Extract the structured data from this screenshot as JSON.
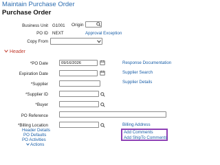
{
  "app": {
    "title": "Maintain Purchase Order"
  },
  "page": {
    "title": "Purchase Order"
  },
  "top_fields": {
    "business_unit_label": "Business Unit",
    "business_unit_value": "G1001",
    "origin_label": "Origin",
    "po_id_label": "PO ID",
    "po_id_value": "NEXT",
    "approval_exception_link": "Approval Exception",
    "copy_from_label": "Copy From"
  },
  "header_section": {
    "title": "Header",
    "po_date_label": "*PO Date",
    "po_date_value": "09/16/2026",
    "response_documentation_link": "Response Documentation",
    "expiration_date_label": "Expiration Date",
    "supplier_search_link": "Supplier Search",
    "supplier_details_link": "Supplier Details",
    "supplier_label": "*Supplier",
    "supplier_id_label": "*Supplier ID",
    "buyer_label": "*Buyer",
    "po_reference_label": "PO Reference",
    "billing_location_label": "*Billing Location",
    "billing_address_link": "Billing Address"
  },
  "links": {
    "header_details": "Header Details",
    "po_defaults": "PO Defaults",
    "po_activities": "PO Activities",
    "actions": "Actions",
    "add_comments": "Add Comments",
    "add_shipto_comments": "Add ShipTo Comments"
  },
  "colors": {
    "link": "#1a5fa8",
    "section_header": "#c0392b",
    "highlight_border": "#8e3fb5"
  }
}
